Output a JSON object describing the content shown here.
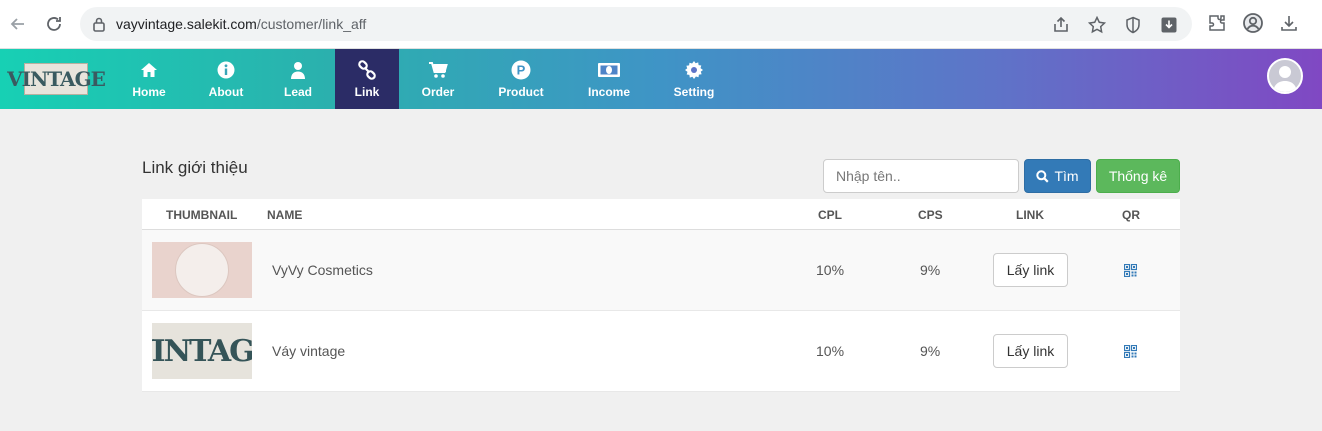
{
  "browser": {
    "url_host": "vayvintage.salekit.com",
    "url_path": "/customer/link_aff"
  },
  "app": {
    "logo_text": "VINTAGE",
    "menu": [
      {
        "label": "Home",
        "icon": "home-icon"
      },
      {
        "label": "About",
        "icon": "info-icon"
      },
      {
        "label": "Lead",
        "icon": "user-icon"
      },
      {
        "label": "Link",
        "icon": "link-icon",
        "active": true
      },
      {
        "label": "Order",
        "icon": "cart-icon"
      },
      {
        "label": "Product",
        "icon": "product-icon"
      },
      {
        "label": "Income",
        "icon": "money-icon"
      },
      {
        "label": "Setting",
        "icon": "gear-icon"
      }
    ]
  },
  "page": {
    "title": "Link giới thiệu",
    "search_placeholder": "Nhập tên..",
    "search_button": "Tìm",
    "stats_button": "Thống kê"
  },
  "table": {
    "headers": {
      "thumbnail": "THUMBNAIL",
      "name": "NAME",
      "cpl": "CPL",
      "cps": "CPS",
      "link": "LINK",
      "qr": "QR"
    },
    "rows": [
      {
        "name": "VyVy Cosmetics",
        "cpl": "10%",
        "cps": "9%",
        "link_button": "Lấy link"
      },
      {
        "name": "Váy vintage",
        "cpl": "10%",
        "cps": "9%",
        "link_button": "Lấy link",
        "thumb_text": "VINTAGE"
      }
    ]
  }
}
